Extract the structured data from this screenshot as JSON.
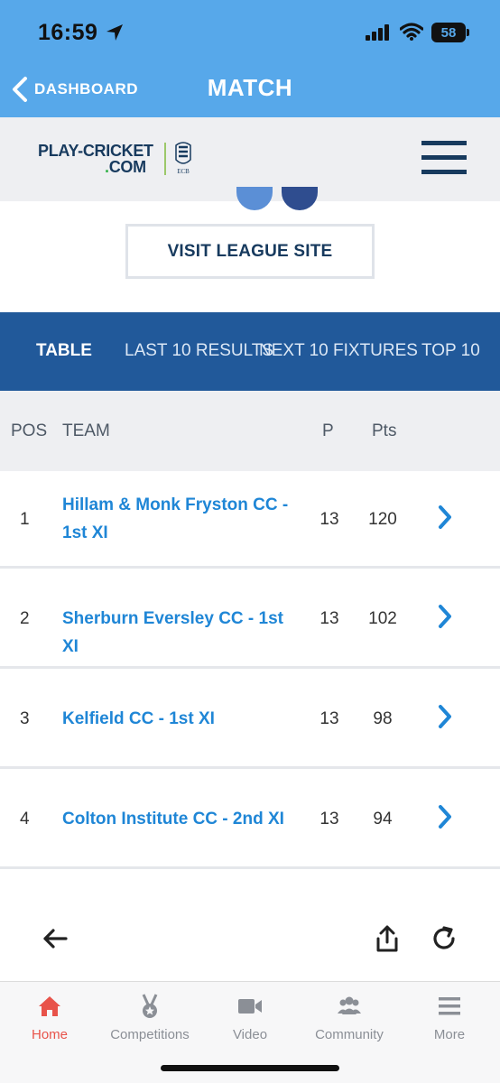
{
  "status_bar": {
    "time": "16:59",
    "battery": "58"
  },
  "nav": {
    "back_label": "DASHBOARD",
    "title": "MATCH"
  },
  "brand": {
    "logo_line1": "PLAY-CRICKET",
    "logo_line2": "COM",
    "logo_dot": ".",
    "crest_text": "ECB"
  },
  "visit_button": "VISIT LEAGUE SITE",
  "tabs": [
    "TABLE",
    "LAST 10 RESULTS",
    "NEXT 10 FIXTURES",
    "TOP 10"
  ],
  "table": {
    "headers": {
      "pos": "POS",
      "team": "TEAM",
      "played": "P",
      "points": "Pts"
    },
    "rows": [
      {
        "pos": "1",
        "team": "Hillam & Monk Fryston CC - 1st XI",
        "played": "13",
        "points": "120"
      },
      {
        "pos": "2",
        "team": "Sherburn Eversley CC - 1st XI",
        "played": "13",
        "points": "102"
      },
      {
        "pos": "3",
        "team": "Kelfield CC - 1st XI",
        "played": "13",
        "points": "98"
      },
      {
        "pos": "4",
        "team": "Colton Institute CC - 2nd XI",
        "played": "13",
        "points": "94"
      }
    ]
  },
  "bottom_nav": [
    {
      "label": "Home",
      "icon": "home-icon",
      "active": true
    },
    {
      "label": "Competitions",
      "icon": "medal-icon",
      "active": false
    },
    {
      "label": "Video",
      "icon": "video-camera-icon",
      "active": false
    },
    {
      "label": "Community",
      "icon": "people-icon",
      "active": false
    },
    {
      "label": "More",
      "icon": "menu-icon",
      "active": false
    }
  ],
  "colors": {
    "header_blue": "#57a8ea",
    "tab_bar": "#21599a",
    "link_blue": "#1f86d6",
    "navy": "#173a5e",
    "active_red": "#e8534a"
  }
}
